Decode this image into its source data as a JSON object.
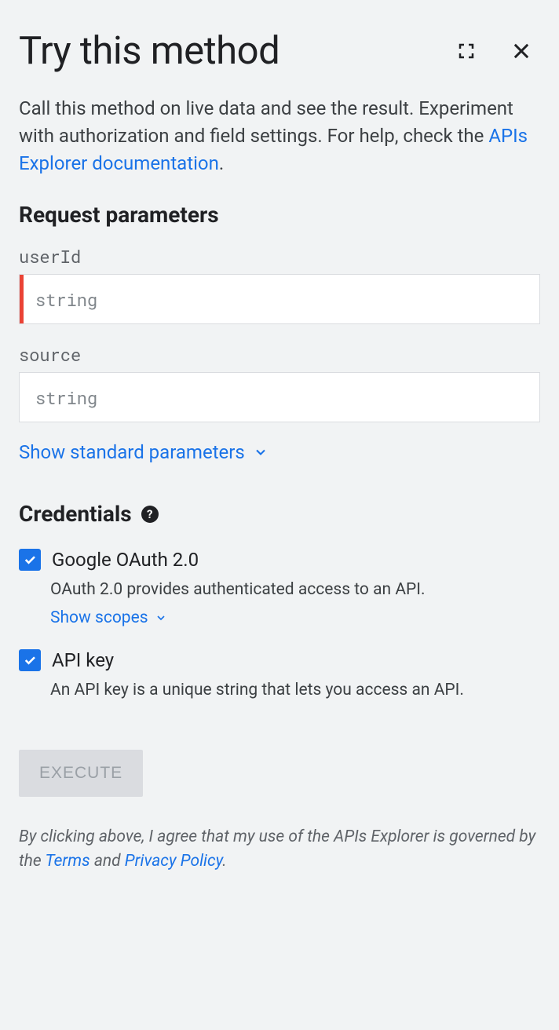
{
  "header": {
    "title": "Try this method"
  },
  "description": {
    "text_prefix": "Call this method on live data and see the result. Experiment with authorization and field settings. For help, check the ",
    "link_text": "APIs Explorer documentation",
    "text_suffix": "."
  },
  "params": {
    "heading": "Request parameters",
    "fields": {
      "userId": {
        "label": "userId",
        "placeholder": "string",
        "required": true
      },
      "source": {
        "label": "source",
        "placeholder": "string",
        "required": false
      }
    },
    "show_standard": "Show standard parameters"
  },
  "credentials": {
    "heading": "Credentials",
    "oauth": {
      "label": "Google OAuth 2.0",
      "sub": "OAuth 2.0 provides authenticated access to an API.",
      "show_scopes": "Show scopes"
    },
    "apikey": {
      "label": "API key",
      "sub": "An API key is a unique string that lets you access an API."
    }
  },
  "execute_label": "EXECUTE",
  "footer": {
    "prefix": "By clicking above, I agree that my use of the APIs Explorer is governed by the ",
    "terms": "Terms",
    "and": " and ",
    "privacy": "Privacy Policy",
    "suffix": "."
  }
}
